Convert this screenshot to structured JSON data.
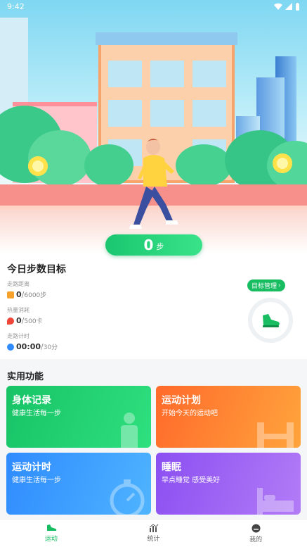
{
  "status_bar": {
    "time": "9:42"
  },
  "hero": {
    "step_count": "0",
    "step_unit": "步"
  },
  "goal": {
    "title": "今日步数目标",
    "manage_label": "目标管理",
    "metrics": [
      {
        "label": "走路距离",
        "current": "0",
        "goal": "6000步",
        "icon": "walk-icon",
        "color": "#f6a12a"
      },
      {
        "label": "热量消耗",
        "current": "0",
        "goal": "500卡",
        "icon": "flame-icon",
        "color": "#f0463a"
      },
      {
        "label": "走路计时",
        "current": "00:00",
        "goal": "30分",
        "icon": "timer-icon",
        "color": "#2f8bff"
      }
    ]
  },
  "features": {
    "title": "实用功能",
    "cards": [
      {
        "title": "身体记录",
        "subtitle": "健康生活每一步"
      },
      {
        "title": "运动计划",
        "subtitle": "开始今天的运动吧"
      },
      {
        "title": "运动计时",
        "subtitle": "健康生活每一步"
      },
      {
        "title": "睡眠",
        "subtitle": "早点睡觉 感受美好"
      }
    ]
  },
  "nav": {
    "items": [
      {
        "label": "运动",
        "icon": "shoe-icon"
      },
      {
        "label": "统计",
        "icon": "chart-icon"
      },
      {
        "label": "我的",
        "icon": "profile-icon"
      }
    ],
    "active": "运动",
    "active_color": "#18bd62"
  }
}
